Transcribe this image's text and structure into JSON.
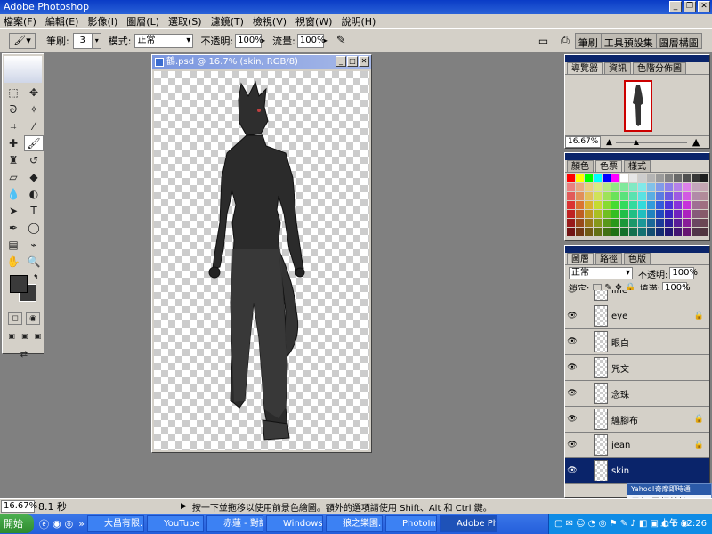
{
  "app": {
    "title": "Adobe Photoshop"
  },
  "menu": [
    "檔案(F)",
    "編輯(E)",
    "影像(I)",
    "圖層(L)",
    "選取(S)",
    "濾鏡(T)",
    "檢視(V)",
    "視窗(W)",
    "說明(H)"
  ],
  "options": {
    "brush_label": "筆刷:",
    "brush_size": "3",
    "mode_label": "模式:",
    "mode_value": "正常",
    "opacity_label": "不透明:",
    "opacity_value": "100%",
    "flow_label": "流量:",
    "flow_value": "100%",
    "wells": [
      "筆刷",
      "工具預設集",
      "圖層構圖"
    ]
  },
  "document": {
    "title": "鶴.psd @ 16.7% (skin, RGB/8)"
  },
  "navigator": {
    "tabs": [
      "導覽器",
      "資訊",
      "色階分佈圖"
    ],
    "zoom": "16.67%"
  },
  "color_panel": {
    "tabs": [
      "顏色",
      "色票",
      "樣式"
    ]
  },
  "layers_panel": {
    "tabs": [
      "圖層",
      "路徑",
      "色版"
    ],
    "mode": "正常",
    "opacity_label": "不透明:",
    "opacity_value": "100%",
    "lock_label": "鎖定:",
    "fill_label": "填滿:",
    "fill_value": "100%",
    "layers": [
      {
        "name": "line",
        "locked": false,
        "selected": false
      },
      {
        "name": "eye",
        "locked": true,
        "selected": false
      },
      {
        "name": "眼白",
        "locked": false,
        "selected": false
      },
      {
        "name": "咒文",
        "locked": false,
        "selected": false
      },
      {
        "name": "念珠",
        "locked": false,
        "selected": false
      },
      {
        "name": "纏腳布",
        "locked": true,
        "selected": false
      },
      {
        "name": "jean",
        "locked": true,
        "selected": false
      },
      {
        "name": "skin",
        "locked": false,
        "selected": true
      }
    ]
  },
  "statusbar": {
    "zoom": "16.67%",
    "info": "8.1 秒",
    "hint": "按一下並拖移以使用前景色繪圖。額外的選項請使用 Shift、Alt 和 Ctrl 鍵。"
  },
  "popup": {
    "title": "Yahoo!奇摩即時通",
    "text": "果仔 已經離線了"
  },
  "taskbar": {
    "start": "開始",
    "quick_more": "»",
    "tasks": [
      "大昌有限...",
      "YouTube ...",
      "赤蓮 - 對話",
      "Windows ...",
      "狼之樂園...",
      "PhotoImp...",
      "Adobe Ph..."
    ],
    "active_task": "Adobe Ph...",
    "clock": "上午 12:26"
  },
  "colors": {
    "title_blue": "#0a246a",
    "taskbar_blue": "#245edb",
    "panel_gray": "#d4d0c8"
  }
}
